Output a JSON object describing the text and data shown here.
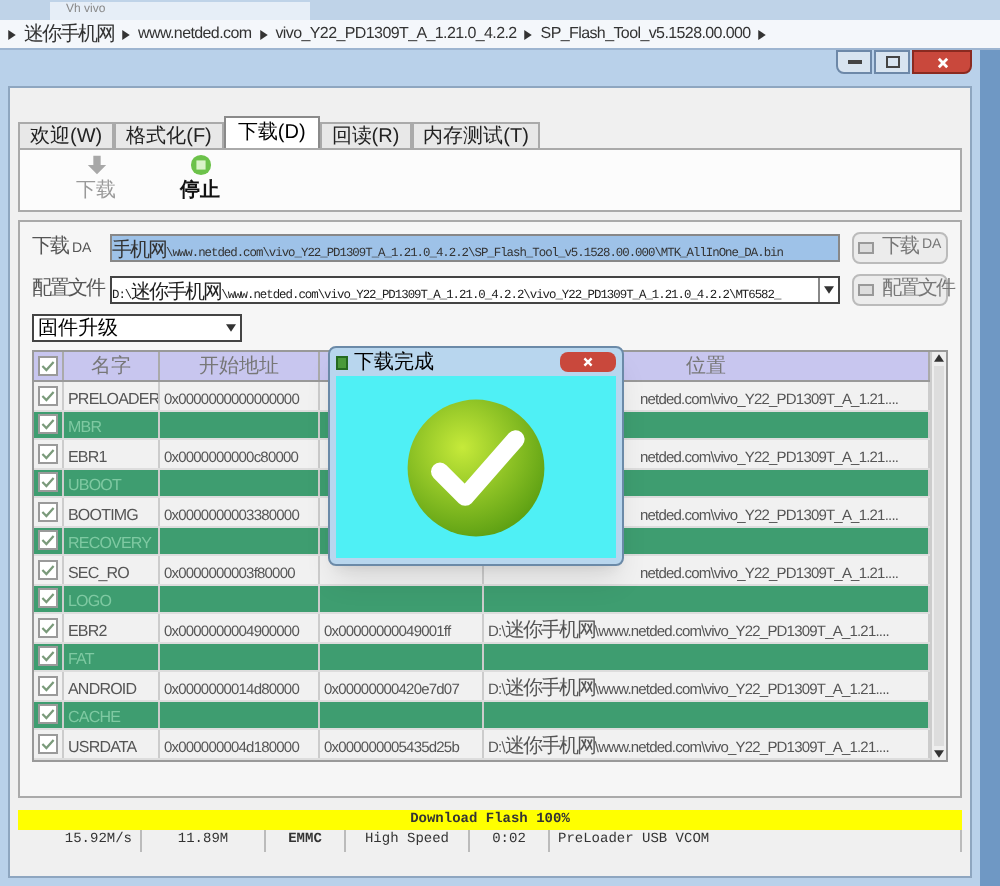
{
  "browser_tab": {
    "title": "Vh vivo"
  },
  "breadcrumb": [
    "迷你手机网",
    "www.netded.com",
    "vivo_Y22_PD1309T_A_1.21.0_4.2.2",
    "SP_Flash_Tool_v5.1528.00.000"
  ],
  "tabs": [
    {
      "label": "欢迎(W)",
      "selected": false
    },
    {
      "label": "格式化(F)",
      "selected": false
    },
    {
      "label": "下载(D)",
      "selected": true
    },
    {
      "label": "回读(R)",
      "selected": false
    },
    {
      "label": "内存测试(T)",
      "selected": false
    }
  ],
  "toolbar": [
    {
      "kind": "download",
      "label": "下载",
      "disabled": true
    },
    {
      "kind": "stop",
      "label": "停止",
      "disabled": false
    }
  ],
  "da": {
    "label": "下载 DA",
    "value": "手机网\\www.netded.com\\vivo_Y22_PD1309T_A_1.21.0_4.2.2\\SP_Flash_Tool_v5.1528.00.000\\MTK_AllInOne_DA.bin",
    "button": "下载 DA"
  },
  "config": {
    "label": "配置文件",
    "value": "D:\\迷你手机网\\www.netded.com\\vivo_Y22_PD1309T_A_1.21.0_4.2.2\\vivo_Y22_PD1309T_A_1.21.0_4.2.2\\MT6582_",
    "button": "配置文件"
  },
  "mode": {
    "value": "固件升级"
  },
  "table": {
    "all_checked": true,
    "columns": [
      "名字",
      "开始地址",
      "",
      "位置"
    ],
    "rows": [
      {
        "checked": true,
        "selected": false,
        "name": "PRELOADER",
        "start": "0x0000000000000000",
        "location": "netded.com\\vivo_Y22_PD1309T_A_1.21...."
      },
      {
        "checked": true,
        "selected": true,
        "name": "MBR"
      },
      {
        "checked": true,
        "selected": false,
        "name": "EBR1",
        "start": "0x0000000000c80000",
        "location": "netded.com\\vivo_Y22_PD1309T_A_1.21...."
      },
      {
        "checked": true,
        "selected": true,
        "name": "UBOOT"
      },
      {
        "checked": true,
        "selected": false,
        "name": "BOOTIMG",
        "start": "0x0000000003380000",
        "location": "netded.com\\vivo_Y22_PD1309T_A_1.21...."
      },
      {
        "checked": true,
        "selected": true,
        "name": "RECOVERY"
      },
      {
        "checked": true,
        "selected": false,
        "name": "SEC_RO",
        "start": "0x0000000003f80000",
        "location": "netded.com\\vivo_Y22_PD1309T_A_1.21...."
      },
      {
        "checked": true,
        "selected": true,
        "name": "LOGO"
      },
      {
        "checked": true,
        "selected": false,
        "name": "EBR2",
        "start": "0x0000000004900000",
        "end": "0x00000000049001ff",
        "location": "D:\\迷你手机网\\www.netded.com\\vivo_Y22_PD1309T_A_1.21...."
      },
      {
        "checked": true,
        "selected": true,
        "name": "FAT"
      },
      {
        "checked": true,
        "selected": false,
        "name": "ANDROID",
        "start": "0x0000000014d80000",
        "end": "0x00000000420e7d07",
        "location": "D:\\迷你手机网\\www.netded.com\\vivo_Y22_PD1309T_A_1.21...."
      },
      {
        "checked": true,
        "selected": true,
        "name": "CACHE"
      },
      {
        "checked": true,
        "selected": false,
        "name": "USRDATA",
        "start": "0x000000004d180000",
        "end": "0x000000005435d25b",
        "location": "D:\\迷你手机网\\www.netded.com\\vivo_Y22_PD1309T_A_1.21...."
      }
    ]
  },
  "dialog": {
    "title": "下载完成"
  },
  "progress": {
    "label": "Download Flash 100%",
    "level": 1
  },
  "status_bar": [
    "15.92M/s",
    "11.89M",
    "EMMC",
    "High Speed",
    "0:02",
    "PreLoader USB VCOM"
  ]
}
